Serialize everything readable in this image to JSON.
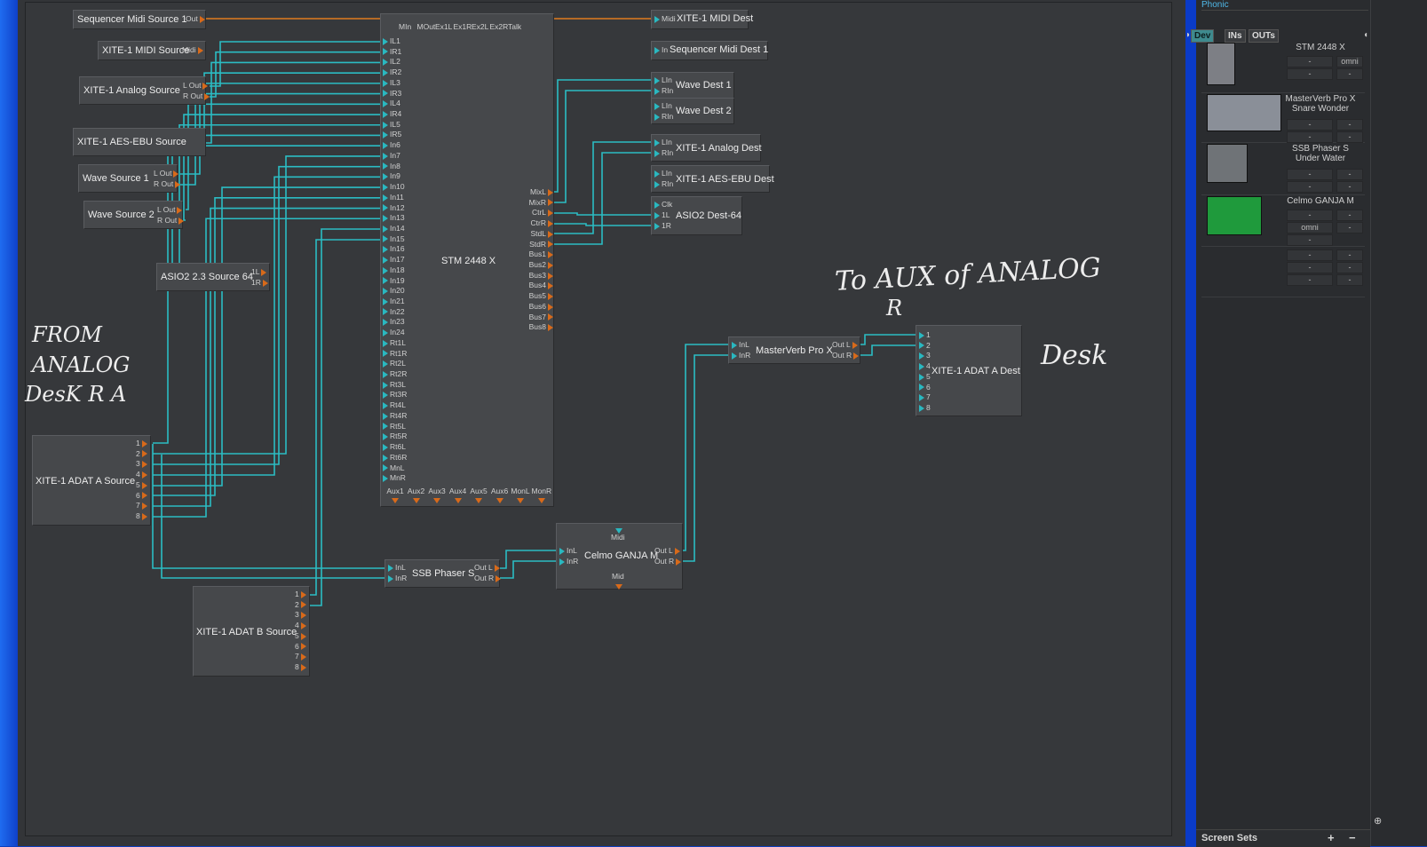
{
  "app": {
    "panel_header": "Phonic"
  },
  "modules": {
    "seq_midi_src": {
      "label": "Sequencer Midi Source 1",
      "port": "Out"
    },
    "xite_midi_src": {
      "label": "XITE-1 MIDI Source",
      "port": "Midi"
    },
    "xite_analog_src": {
      "label": "XITE-1 Analog Source",
      "ports": [
        "L Out",
        "R Out"
      ]
    },
    "xite_aes_src": {
      "label": "XITE-1 AES-EBU Source"
    },
    "wave_src1": {
      "label": "Wave Source 1",
      "ports": [
        "L Out",
        "R Out"
      ]
    },
    "wave_src2": {
      "label": "Wave Source 2",
      "ports": [
        "L Out",
        "R Out"
      ]
    },
    "asio_src": {
      "label": "ASIO2 2.3 Source 64",
      "ports": [
        "1L",
        "1R"
      ]
    },
    "adat_a_src": {
      "label": "XITE-1 ADAT A Source",
      "ports": [
        "1",
        "2",
        "3",
        "4",
        "5",
        "6",
        "7",
        "8"
      ]
    },
    "adat_b_src": {
      "label": "XITE-1 ADAT B Source",
      "ports": [
        "1",
        "2",
        "3",
        "4",
        "5",
        "6",
        "7",
        "8"
      ]
    },
    "stm": {
      "label": "STM 2448 X",
      "top_ports": [
        "MIn",
        "MOut",
        "Ex1L",
        "Ex1R",
        "Ex2L",
        "Ex2R",
        "Talk"
      ],
      "in_ports": [
        "IL1",
        "IR1",
        "IL2",
        "IR2",
        "IL3",
        "IR3",
        "IL4",
        "IR4",
        "IL5",
        "IR5",
        "In6",
        "In7",
        "In8",
        "In9",
        "In10",
        "In11",
        "In12",
        "In13",
        "In14",
        "In15",
        "In16",
        "In17",
        "In18",
        "In19",
        "In20",
        "In21",
        "In22",
        "In23",
        "In24",
        "Rt1L",
        "Rt1R",
        "Rt2L",
        "Rt2R",
        "Rt3L",
        "Rt3R",
        "Rt4L",
        "Rt4R",
        "Rt5L",
        "Rt5R",
        "Rt6L",
        "Rt6R",
        "MnL",
        "MnR"
      ],
      "out_ports": [
        "MixL",
        "MixR",
        "CtrL",
        "CtrR",
        "StdL",
        "StdR",
        "Bus1",
        "Bus2",
        "Bus3",
        "Bus4",
        "Bus5",
        "Bus6",
        "Bus7",
        "Bus8"
      ],
      "bottom_ports": [
        "Aux1",
        "Aux2",
        "Aux3",
        "Aux4",
        "Aux5",
        "Aux6",
        "MonL",
        "MonR"
      ]
    },
    "xite_midi_dest": {
      "label": "XITE-1 MIDI Dest",
      "port": "Midi"
    },
    "seq_midi_dest": {
      "label": "Sequencer Midi Dest 1",
      "port": "In"
    },
    "wave_dest1": {
      "label": "Wave Dest 1",
      "ports": [
        "LIn",
        "RIn"
      ]
    },
    "wave_dest2": {
      "label": "Wave Dest 2",
      "ports": [
        "LIn",
        "RIn"
      ]
    },
    "xite_analog_dest": {
      "label": "XITE-1 Analog Dest",
      "ports": [
        "LIn",
        "RIn"
      ]
    },
    "xite_aes_dest": {
      "label": "XITE-1 AES-EBU Dest",
      "ports": [
        "LIn",
        "RIn"
      ]
    },
    "asio_dest": {
      "label": "ASIO2 Dest-64",
      "ports": [
        "Clk",
        "1L",
        "1R"
      ]
    },
    "masterverb": {
      "label": "MasterVerb Pro X",
      "ins": [
        "InL",
        "InR"
      ],
      "outs": [
        "Out L",
        "Out R"
      ]
    },
    "adat_a_dest": {
      "label": "XITE-1 ADAT A Dest",
      "ports": [
        "1",
        "2",
        "3",
        "4",
        "5",
        "6",
        "7",
        "8"
      ]
    },
    "ssb": {
      "label": "SSB Phaser S",
      "ins": [
        "InL",
        "InR"
      ],
      "outs": [
        "Out L",
        "Out R"
      ]
    },
    "celmo": {
      "label": "Celmo GANJA M",
      "ins": [
        "InL",
        "InR"
      ],
      "outs": [
        "Out L",
        "Out R"
      ],
      "midi_in": "Midi",
      "midi_out": "Mid"
    }
  },
  "annotations": {
    "left_lines": [
      "FROM",
      "ANALOG",
      "DesK R A"
    ],
    "right_line1": "To AUX of ANALOG",
    "right_line2": "R",
    "right_line3": "Desk"
  },
  "panel": {
    "tabs": [
      "Dev",
      "INs",
      "OUTs"
    ],
    "devices": [
      {
        "name": "STM 2448 X",
        "fields": [
          "-",
          "omni",
          "-",
          "-"
        ]
      },
      {
        "name": "MasterVerb Pro X Snare Wonder",
        "fields": [
          "-",
          "-",
          "-",
          "-"
        ]
      },
      {
        "name": "SSB Phaser S Under Water",
        "fields": [
          "-",
          "-",
          "-",
          "-"
        ]
      },
      {
        "name": "Celmo GANJA M",
        "fields": [
          "-",
          "-",
          "omni",
          "-",
          "-"
        ]
      },
      {
        "name": "",
        "fields": [
          "-",
          "-",
          "-",
          "-",
          "-",
          "-"
        ]
      }
    ],
    "screen_sets": "Screen Sets",
    "plus": "+",
    "minus": "−"
  },
  "colors": {
    "wire": "#2bbcc3",
    "midi_wire": "#e07a1e",
    "canvas": "#36383b",
    "accent": "#2ab8c0"
  }
}
